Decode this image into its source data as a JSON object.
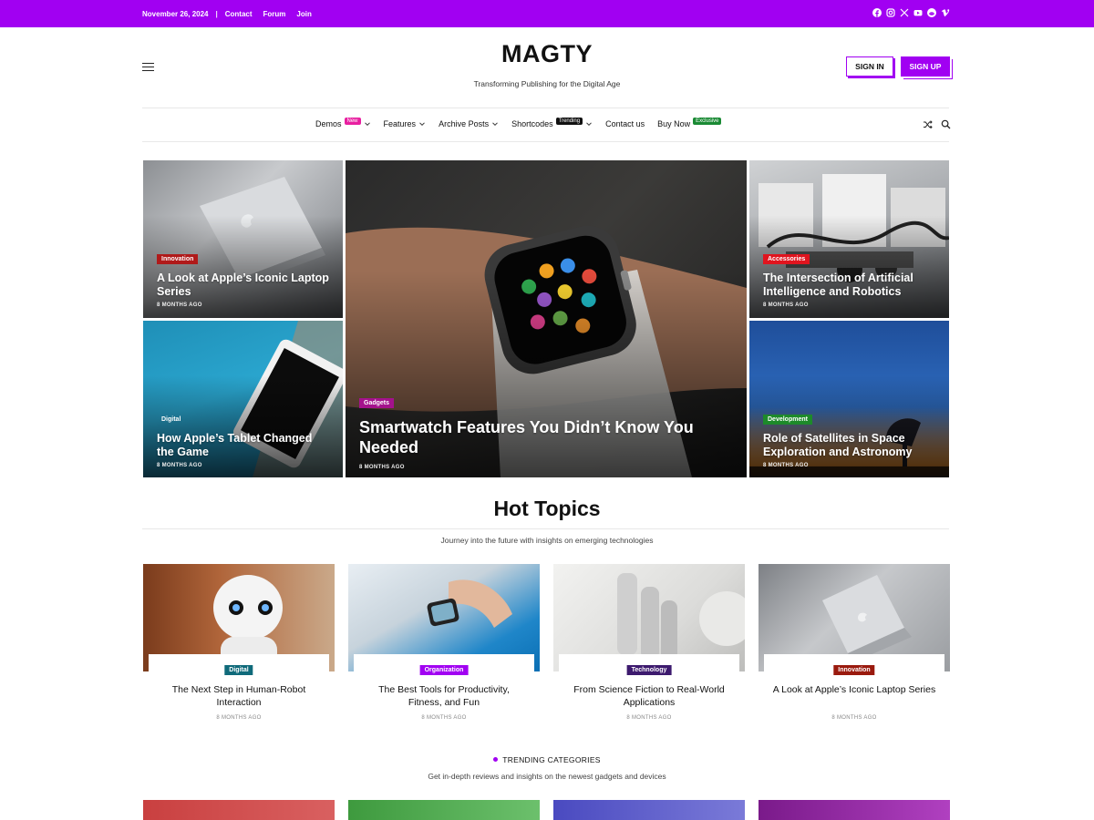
{
  "topbar": {
    "date": "November 26, 2024",
    "separator": "|",
    "links": [
      "Contact",
      "Forum",
      "Join"
    ],
    "social_icons": [
      "facebook-icon",
      "instagram-icon",
      "x-icon",
      "youtube-icon",
      "reddit-icon",
      "vimeo-icon"
    ],
    "bg_color": "#a100f2"
  },
  "header": {
    "logo": "MAGTY",
    "tagline": "Transforming Publishing for the Digital Age",
    "signin_label": "SIGN IN",
    "signup_label": "SIGN UP"
  },
  "nav": {
    "items": [
      {
        "label": "Demos",
        "badge": "New",
        "badge_color": "#e81fa0",
        "dropdown": true
      },
      {
        "label": "Features",
        "badge": "",
        "dropdown": true
      },
      {
        "label": "Archive Posts",
        "badge": "",
        "dropdown": true
      },
      {
        "label": "Shortcodes",
        "badge": "Trending",
        "badge_color": "#111111",
        "dropdown": true
      },
      {
        "label": "Contact us",
        "badge": "",
        "dropdown": false
      },
      {
        "label": "Buy Now",
        "badge": "Exclusive",
        "badge_color": "#1a8a34",
        "dropdown": false
      }
    ],
    "tools": [
      "shuffle-icon",
      "search-icon"
    ]
  },
  "hero": {
    "left_top": {
      "category": "Innovation",
      "category_color": "#b01a1a",
      "title": "A Look at Apple’s Iconic Laptop Series",
      "meta": "8 MONTHS AGO"
    },
    "left_bottom": {
      "category": "Digital",
      "category_color": "transparent",
      "title": "How Apple’s Tablet Changed the Game",
      "meta": "8 MONTHS AGO"
    },
    "center": {
      "category": "Gadgets",
      "category_color": "#a4128c",
      "title": "Smartwatch Features You Didn’t Know You Needed",
      "meta": "8 MONTHS AGO"
    },
    "right_top": {
      "category": "Accessories",
      "category_color": "#e0141e",
      "title": "The Intersection of Artificial Intelligence and Robotics",
      "meta": "8 MONTHS AGO"
    },
    "right_bottom": {
      "category": "Development",
      "category_color": "#1d8a2a",
      "title": "Role of Satellites in Space Exploration and Astronomy",
      "meta": "8 MONTHS AGO"
    }
  },
  "hot_topics": {
    "title": "Hot Topics",
    "subtitle": "Journey into the future with insights on emerging technologies",
    "cards": [
      {
        "category": "Digital",
        "category_color": "#0f6a7a",
        "title": "The Next Step in Human-Robot Interaction",
        "meta": "8 MONTHS AGO"
      },
      {
        "category": "Organization",
        "category_color": "#a100f2",
        "title": "The Best Tools for Productivity, Fitness, and Fun",
        "meta": "8 MONTHS AGO"
      },
      {
        "category": "Technology",
        "category_color": "#3d1a6e",
        "title": "From Science Fiction to Real-World Applications",
        "meta": "8 MONTHS AGO"
      },
      {
        "category": "Innovation",
        "category_color": "#9a1a0e",
        "title": "A Look at Apple’s Iconic Laptop Series",
        "meta": "8 MONTHS AGO"
      }
    ]
  },
  "trending": {
    "label": "TRENDING CATEGORIES",
    "subtitle": "Get in-depth reviews and insights on the newest gadgets and devices"
  }
}
